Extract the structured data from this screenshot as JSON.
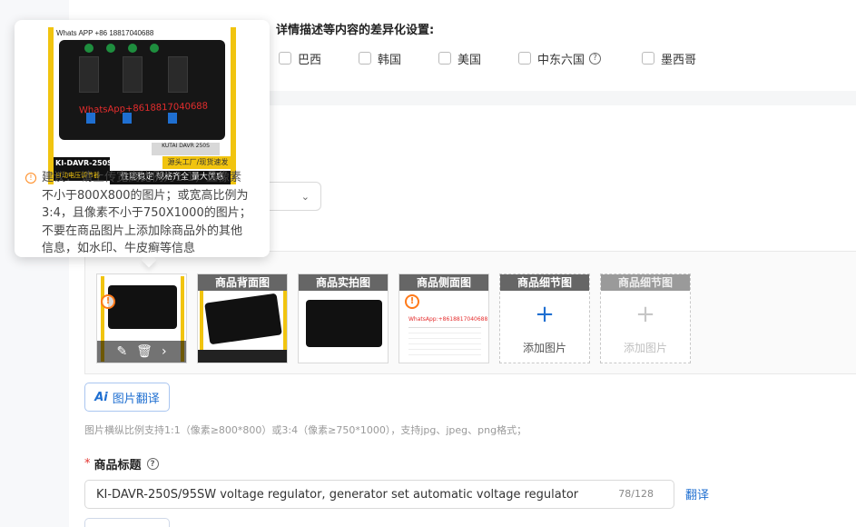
{
  "diff_settings": {
    "title": "详情描述等内容的差异化设置:",
    "countries": [
      {
        "label": "巴西",
        "checked": false
      },
      {
        "label": "韩国",
        "checked": false
      },
      {
        "label": "美国",
        "checked": false
      },
      {
        "label": "中东六国",
        "checked": false,
        "help_icon": "question-circle-icon"
      },
      {
        "label": "墨西哥",
        "checked": false
      }
    ]
  },
  "tooltip": {
    "preview": {
      "whatsapp_text": "Whats APP +86 18817040688",
      "watermark_text": "WhatsApp+8618817040688",
      "model_label": "KI-DAVR-250S",
      "model_sub": "自动电压调节器",
      "factory_tag": "源头工厂/现货速发",
      "slogan": "性能稳定  规格齐全  量大优惠",
      "label_text": "KUTAI DAVR 250S"
    },
    "advice_lines": [
      "建议： 请上传宽高比例为1:1，且像素",
      "不小于800X800的图片；或宽高比例为",
      "3:4，且像素不小于750X1000的图片；",
      "不要在商品图片上添加除商品外的其他",
      "信息，如水印、牛皮癣等信息"
    ],
    "advice_icon": "info-circle-icon"
  },
  "images": {
    "slots": [
      {
        "caption": "",
        "type": "main",
        "has_warning": true,
        "actions": [
          "edit-icon",
          "delete-icon",
          "chevron-right-icon"
        ]
      },
      {
        "caption": "商品背面图",
        "type": "image"
      },
      {
        "caption": "商品实拍图",
        "type": "image"
      },
      {
        "caption": "商品侧面图",
        "type": "image",
        "has_warning": true,
        "watermark_text": "WhatsApp:+8618817040688"
      },
      {
        "caption": "商品细节图",
        "type": "add",
        "add_label": "添加图片",
        "enabled": true
      },
      {
        "caption": "商品细节图",
        "type": "add",
        "add_label": "添加图片",
        "enabled": false
      }
    ],
    "translate_button": "图片翻译",
    "translate_icon": "ai-icon",
    "hint": "图片横纵比例支持1:1（像素≥800*800）或3:4（像素≥750*1000），支持jpg、jpeg、png格式；"
  },
  "product_title": {
    "label": "商品标题",
    "required_mark": "*",
    "help_icon": "question-circle-icon",
    "value": "KI-DAVR-250S/95SW voltage regulator, generator set automatic voltage regulator",
    "count": "78/128",
    "translate_link": "翻译"
  },
  "colors": {
    "accent": "#1f6fd1",
    "warning": "#ff7a1a",
    "brand_yellow": "#f1c40f",
    "required": "#e3342f"
  }
}
